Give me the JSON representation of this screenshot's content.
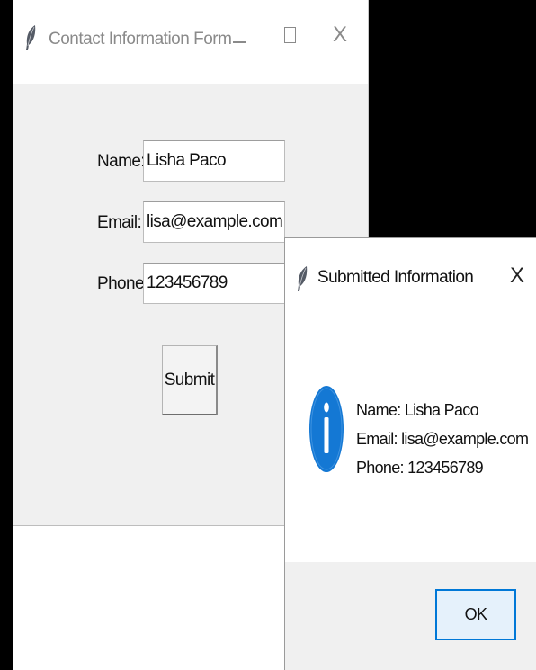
{
  "main_window": {
    "title": "Contact Information Form",
    "close_glyph": "X",
    "icon": "feather-icon",
    "form": {
      "name_label": "Name:",
      "name_value": "Lisha Paco",
      "email_label": "Email:",
      "email_value": "lisa@example.com",
      "phone_label": "Phone:",
      "phone_value": "123456789",
      "submit_label": "Submit"
    }
  },
  "dialog": {
    "title": "Submitted Information",
    "close_glyph": "X",
    "icon": "feather-icon",
    "message_icon": "info-icon",
    "message_lines": [
      "Name: Lisha Paco",
      "Email: lisa@example.com",
      "Phone: 123456789"
    ],
    "ok_label": "OK"
  },
  "colors": {
    "info_blue": "#1478d4",
    "focus_border": "#0078d7",
    "window_bg": "#f0f0f0",
    "titlebar_bg": "#ffffff"
  }
}
